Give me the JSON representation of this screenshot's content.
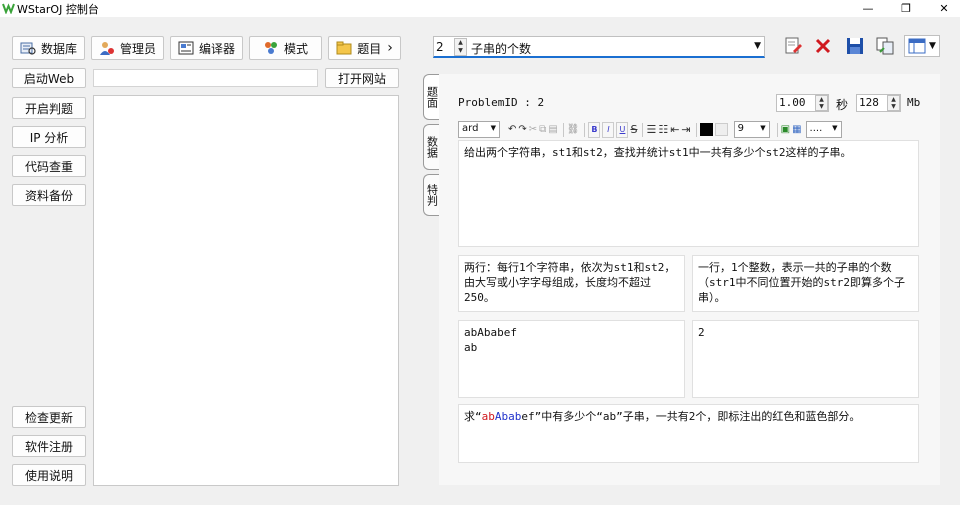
{
  "window": {
    "title": "WStarOJ 控制台",
    "minimize": "—",
    "maximize": "❐",
    "close": "✕"
  },
  "top_buttons": [
    {
      "label": "数据库",
      "icon": "database-icon"
    },
    {
      "label": "管理员",
      "icon": "admin-user-icon"
    },
    {
      "label": "编译器",
      "icon": "compiler-icon"
    },
    {
      "label": "模式",
      "icon": "mode-icon"
    },
    {
      "label": "题目",
      "icon": "problem-folder-icon",
      "chevron": "›"
    }
  ],
  "left_buttons": {
    "start_web": "启动Web",
    "open_site": "打开网站",
    "web_url_value": "",
    "items": [
      "开启判题",
      "IP 分析",
      "代码查重",
      "资料备份"
    ],
    "bottom": [
      "检查更新",
      "软件注册",
      "使用说明"
    ]
  },
  "problem_selector": {
    "number": "2",
    "title": "子串的个数"
  },
  "right_toolbar_icons": [
    "edit-doc-icon",
    "delete-icon",
    "save-icon",
    "copy-doc-icon",
    "layout-icon"
  ],
  "tabs": [
    "题面",
    "数据",
    "特判"
  ],
  "problem": {
    "id_label": "ProblemID : 2",
    "time_limit": "1.00",
    "time_unit": "秒",
    "memory_limit": "128",
    "memory_unit": "Mb"
  },
  "editor_toolbar": {
    "font_name": "ard",
    "font_size": "9",
    "more": "...."
  },
  "content": {
    "description": "给出两个字符串，st1和st2，查找并统计st1中一共有多少个st2这样的子串。",
    "input_desc": "两行：每行1个字符串，依次为st1和st2，由大写或小字字母组成，长度均不超过250。",
    "output_desc": "一行，1个整数，表示一共的子串的个数（str1中不同位置开始的str2即算多个子串）。",
    "sample_input": "abAbabef\nab",
    "sample_output": "2",
    "hint_prefix": "求“",
    "hint_red": "ab",
    "hint_blue": "Ab",
    "hint_red2": "ab",
    "hint_rest": "ef”中有多少个“ab”子串，一共有2个，即标注出的红色和蓝色部分。"
  },
  "colors": {
    "red": "#d0191f",
    "blue": "#2233cc",
    "accent": "#1a6fd1",
    "green": "#3aa33a"
  }
}
